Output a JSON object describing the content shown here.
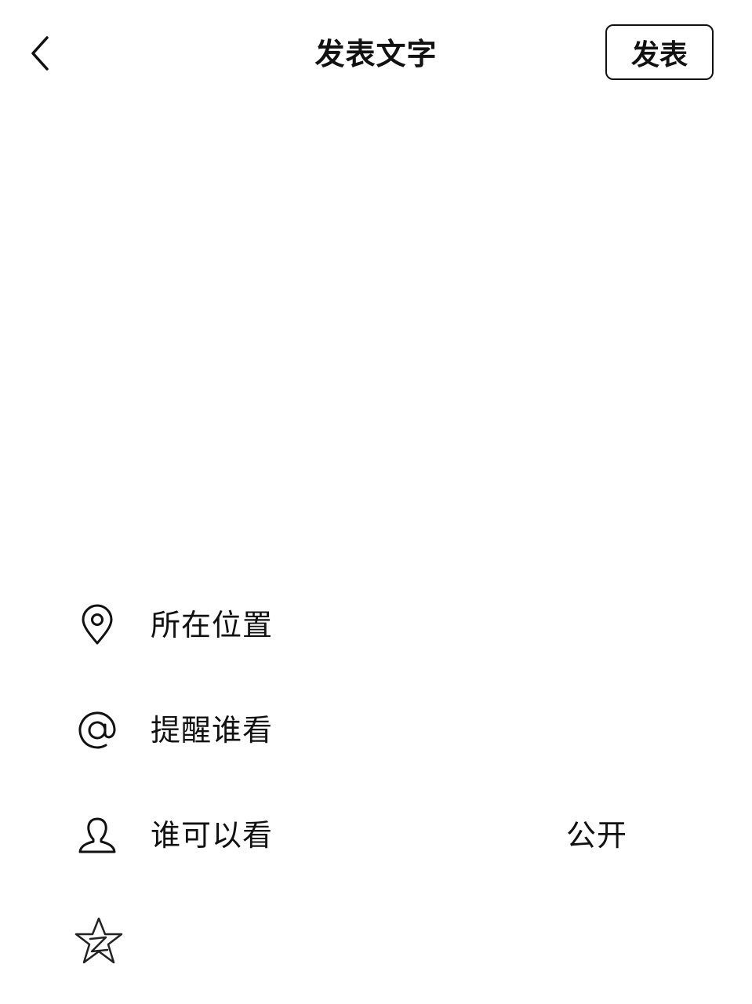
{
  "header": {
    "title": "发表文字",
    "publish_label": "发表"
  },
  "composer": {
    "text": "",
    "placeholder": ""
  },
  "options": {
    "location": {
      "label": "所在位置",
      "icon": "location-pin-icon"
    },
    "mention": {
      "label": "提醒谁看",
      "icon": "at-sign-icon"
    },
    "visibility": {
      "label": "谁可以看",
      "value": "公开",
      "icon": "person-icon"
    },
    "extra": {
      "icon": "star-icon"
    }
  },
  "colors": {
    "text": "#111111",
    "background": "#ffffff"
  }
}
